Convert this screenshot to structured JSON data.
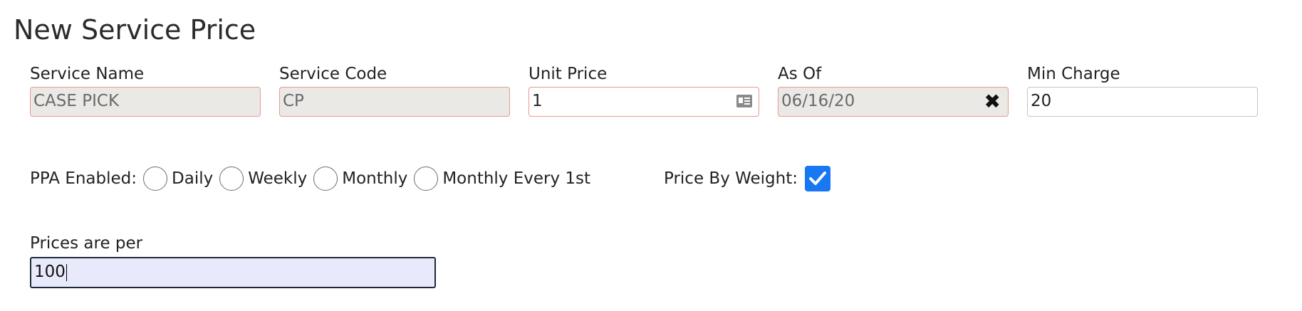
{
  "page": {
    "title": "New Service Price"
  },
  "fields": {
    "service_name": {
      "label": "Service Name",
      "value": "CASE PICK"
    },
    "service_code": {
      "label": "Service Code",
      "value": "CP"
    },
    "unit_price": {
      "label": "Unit Price",
      "value": "1",
      "icon": "contact-card-icon"
    },
    "as_of": {
      "label": "As Of",
      "value": "06/16/20",
      "icon": "clear-x-icon",
      "clear_glyph": "✖"
    },
    "min_charge": {
      "label": "Min Charge",
      "value": "20"
    }
  },
  "ppa": {
    "label": "PPA Enabled:",
    "options": [
      "Daily",
      "Weekly",
      "Monthly",
      "Monthly Every 1st"
    ],
    "selected": null
  },
  "price_by_weight": {
    "label": "Price By Weight:",
    "checked": true,
    "color": "#1877f2"
  },
  "prices_per": {
    "label": "Prices are per",
    "value": "100",
    "focused": true
  },
  "colors": {
    "invalid_border": "#e59a92",
    "readonly_bg": "#ebe9e6",
    "focus_bg": "#e8eafc",
    "checkbox": "#1877f2"
  }
}
